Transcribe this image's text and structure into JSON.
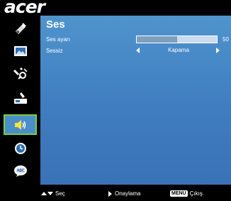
{
  "brand": {
    "logo": "acer"
  },
  "sidebar": {
    "items": [
      {
        "icon": "color-palette-icon",
        "active": false
      },
      {
        "icon": "image-icon",
        "active": false
      },
      {
        "icon": "settings-icon",
        "active": false
      },
      {
        "icon": "management-icon",
        "active": false
      },
      {
        "icon": "speaker-icon",
        "active": true
      },
      {
        "icon": "timer-icon",
        "active": false
      },
      {
        "icon": "language-icon",
        "active": false
      }
    ]
  },
  "panel": {
    "title": "Ses",
    "volume": {
      "label": "Ses ayarı",
      "value": 50,
      "value_text": "50"
    },
    "mute": {
      "label": "Sessiz",
      "value": "Kapama"
    }
  },
  "footer": {
    "select": "Seç",
    "confirm": "Onaylama",
    "menu_key": "MENU",
    "exit": "Çıkış"
  },
  "colors": {
    "accent": "#4b8fc9",
    "highlight": "#7acf3a",
    "panel": "#4a8dcc"
  }
}
